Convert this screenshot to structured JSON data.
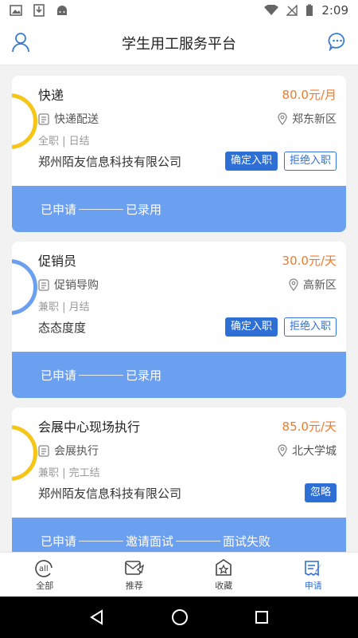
{
  "status_bar": {
    "time": "2:09"
  },
  "header": {
    "title": "学生用工服务平台"
  },
  "jobs": [
    {
      "title": "快递",
      "salary": "80.0元/月",
      "category": "快递配送",
      "location": "郑东新区",
      "meta": "全职 | 日结",
      "company": "郑州陌友信息科技有限公司",
      "buttons": [
        "确定入职",
        "拒绝入职"
      ],
      "progress": [
        "已申请",
        "已录用"
      ],
      "ring_color": "#f5c518"
    },
    {
      "title": "促销员",
      "salary": "30.0元/天",
      "category": "促销导购",
      "location": "高新区",
      "meta": "兼职 | 月结",
      "company": "态态度度",
      "buttons": [
        "确定入职",
        "拒绝入职"
      ],
      "progress": [
        "已申请",
        "已录用"
      ],
      "ring_color": "#6b9ff0"
    },
    {
      "title": "会展中心现场执行",
      "salary": "85.0元/天",
      "category": "会展执行",
      "location": "北大学城",
      "meta": "兼职 | 完工结",
      "company": "郑州陌友信息科技有限公司",
      "buttons": [
        "忽略"
      ],
      "progress": [
        "已申请",
        "邀请面试",
        "面试失败"
      ],
      "ring_color": "#f5c518"
    }
  ],
  "tabs": [
    {
      "label": "全部",
      "icon": "all-icon"
    },
    {
      "label": "推荐",
      "icon": "recommend-icon"
    },
    {
      "label": "收藏",
      "icon": "favorite-icon"
    },
    {
      "label": "申请",
      "icon": "apply-icon"
    }
  ],
  "colors": {
    "accent": "#2e6fd6",
    "salary": "#f07a2b",
    "progress_bg": "#6b9ff0"
  }
}
